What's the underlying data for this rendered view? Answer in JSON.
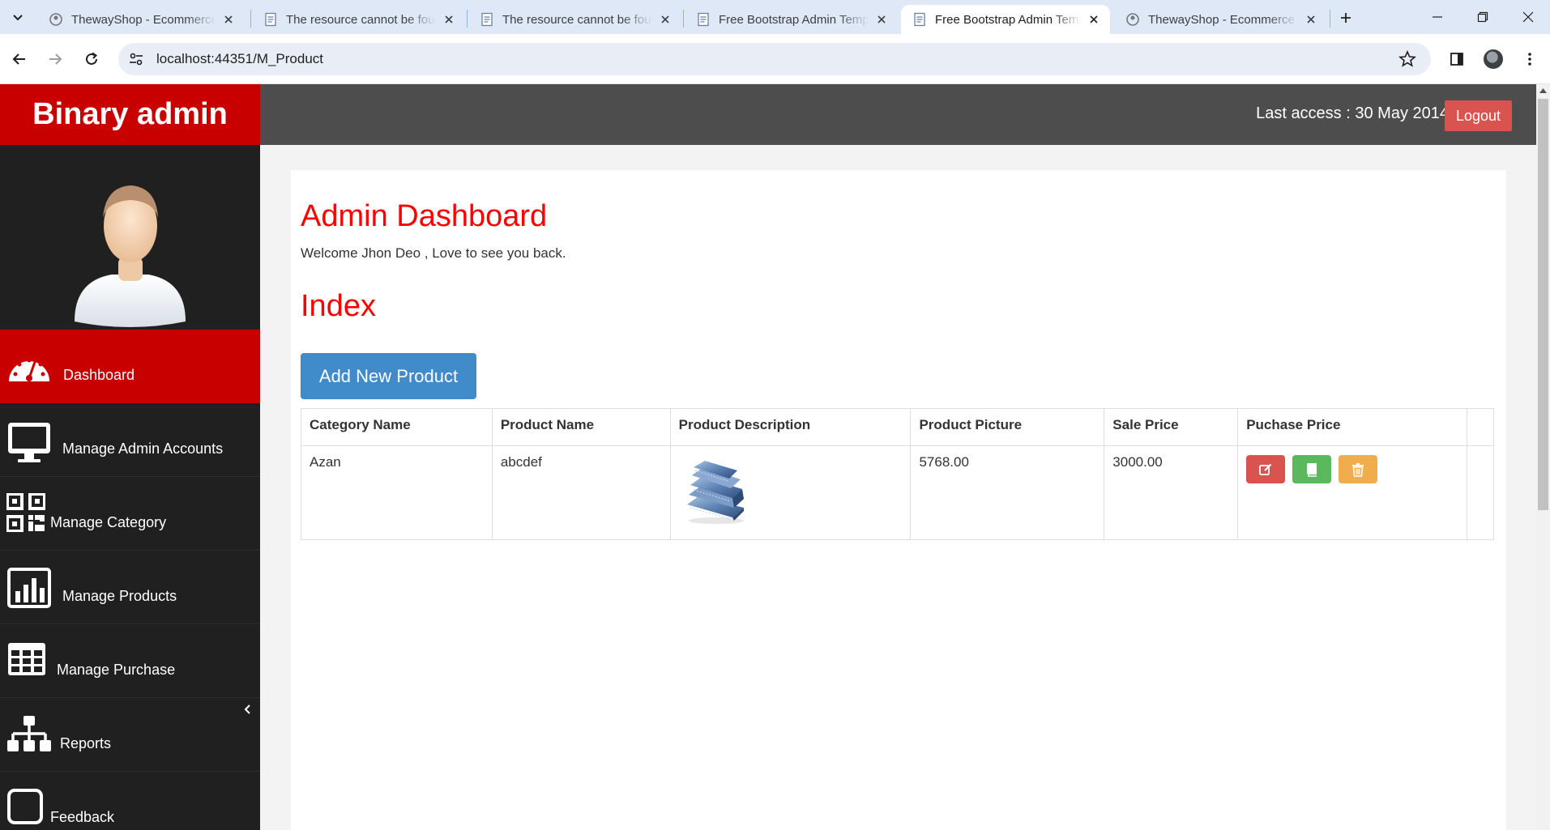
{
  "browser": {
    "tabs": [
      {
        "title": "ThewayShop - Ecommerce",
        "active": false
      },
      {
        "title": "The resource cannot be found",
        "active": false
      },
      {
        "title": "The resource cannot be found",
        "active": false
      },
      {
        "title": "Free Bootstrap Admin Template",
        "active": false
      },
      {
        "title": "Free Bootstrap Admin Template",
        "active": true
      },
      {
        "title": "ThewayShop - Ecommerce",
        "active": false
      }
    ],
    "url": "localhost:44351/M_Product"
  },
  "header": {
    "brand": "Binary admin",
    "last_access": "Last access : 30 May 2014",
    "logout_label": "Logout"
  },
  "sidebar": {
    "items": [
      {
        "label": "Dashboard",
        "icon": "dashboard-icon",
        "active": true
      },
      {
        "label": "Manage Admin Accounts",
        "icon": "desktop-icon",
        "active": false
      },
      {
        "label": "Manage Category",
        "icon": "qrcode-icon",
        "active": false
      },
      {
        "label": "Manage Products",
        "icon": "bar-chart-icon",
        "active": false
      },
      {
        "label": "Manage Purchase",
        "icon": "table-icon",
        "active": false
      },
      {
        "label": "Reports",
        "icon": "sitemap-icon",
        "active": false
      },
      {
        "label": "Feedback",
        "icon": "square-icon",
        "active": false
      }
    ]
  },
  "main": {
    "title": "Admin Dashboard",
    "welcome": "Welcome Jhon Deo , Love to see you back.",
    "subtitle": "Index",
    "add_button": "Add New Product",
    "table": {
      "headers": [
        "Category Name",
        "Product Name",
        "Product Description",
        "Product Picture",
        "Sale Price",
        "Puchase Price",
        ""
      ],
      "rows": [
        {
          "category": "Azan",
          "name": "abcdef",
          "description_image": "jeans-image",
          "picture": "5768.00",
          "sale_price": "3000.00"
        }
      ]
    }
  },
  "colors": {
    "brand_red": "#c90000",
    "heading_red": "#ff0000",
    "topbar": "#4d4d4d",
    "sidebar": "#202020",
    "primary": "#428bca",
    "danger": "#d9534f",
    "success": "#5cb85c",
    "warning": "#f0ad4e"
  }
}
